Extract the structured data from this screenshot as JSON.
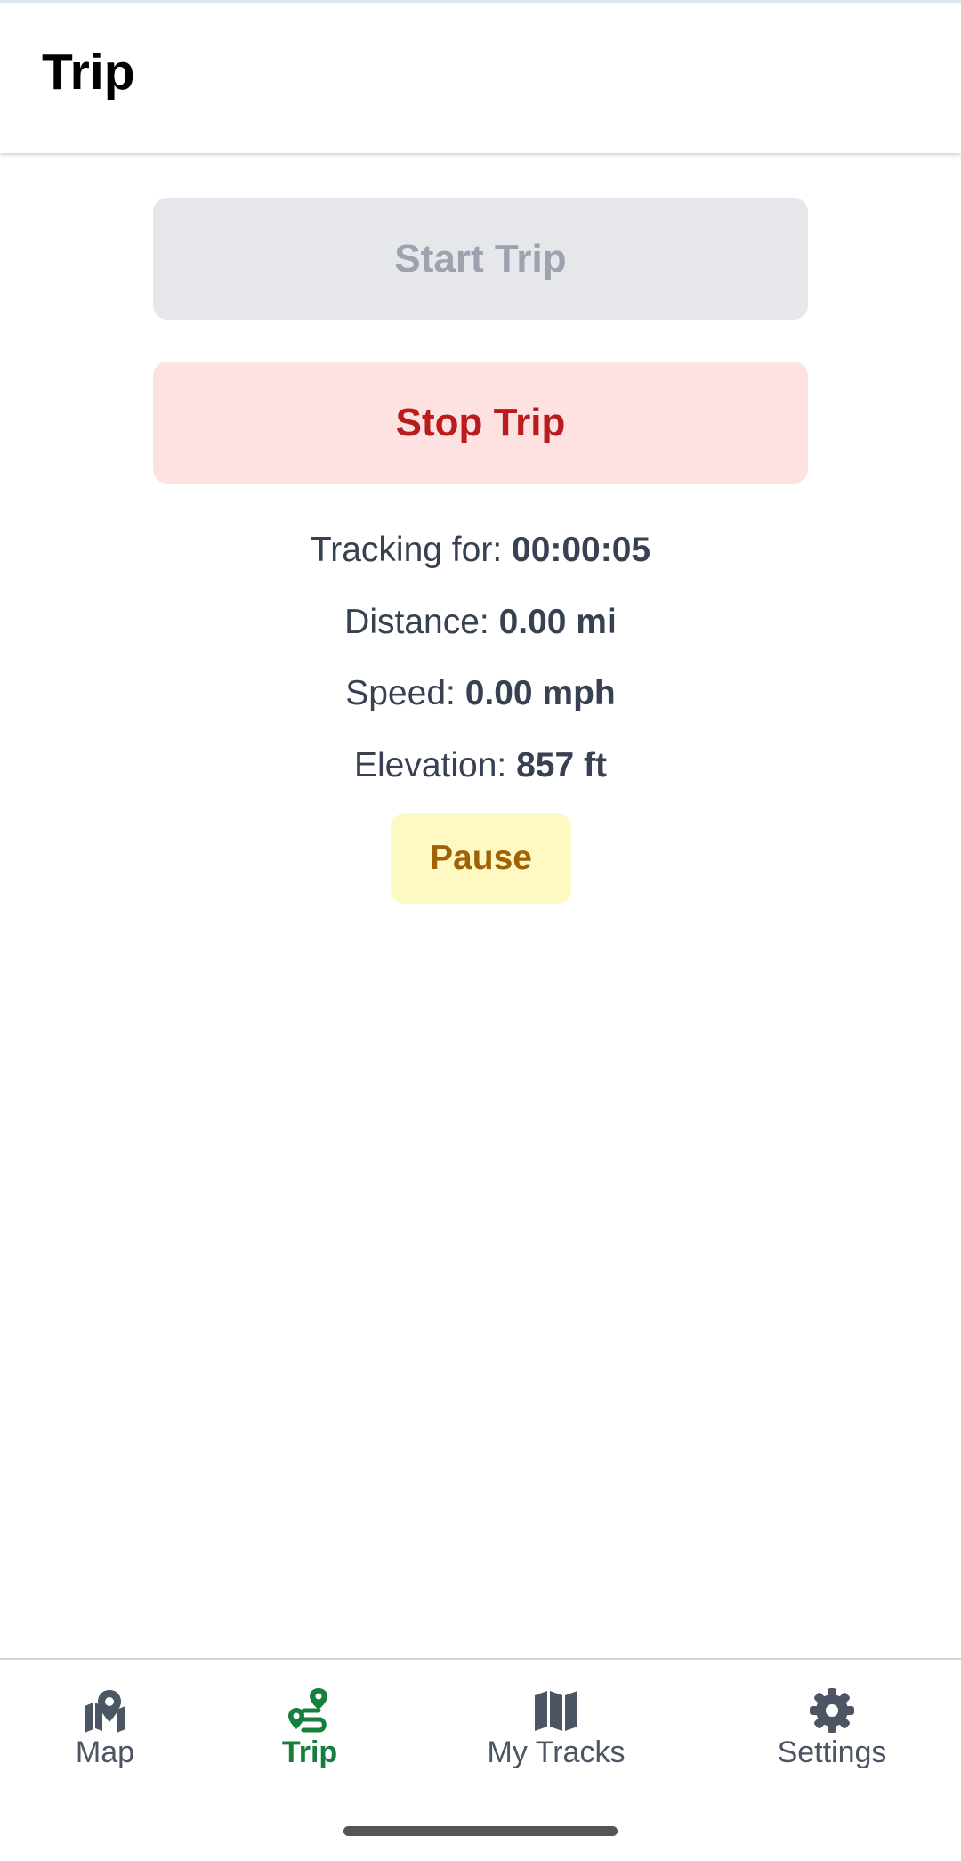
{
  "header": {
    "title": "Trip"
  },
  "actions": {
    "start_label": "Start Trip",
    "stop_label": "Stop Trip",
    "pause_label": "Pause"
  },
  "stats": {
    "tracking_label": "Tracking for: ",
    "tracking_value": "00:00:05",
    "distance_label": "Distance: ",
    "distance_value": "0.00 mi",
    "speed_label": "Speed: ",
    "speed_value": "0.00 mph",
    "elevation_label": "Elevation: ",
    "elevation_value": "857 ft"
  },
  "tabs": [
    {
      "label": "Map",
      "icon": "map-pin-icon",
      "active": false
    },
    {
      "label": "Trip",
      "icon": "route-icon",
      "active": true
    },
    {
      "label": "My Tracks",
      "icon": "folded-map-icon",
      "active": false
    },
    {
      "label": "Settings",
      "icon": "gear-icon",
      "active": false
    }
  ],
  "colors": {
    "active_tab": "#15803d",
    "inactive_tab": "#4b5563",
    "start_bg": "#e5e7eb",
    "stop_bg": "#fee2e2",
    "stop_text": "#b91c1c",
    "pause_bg": "#fef9c3",
    "pause_text": "#a16207"
  }
}
